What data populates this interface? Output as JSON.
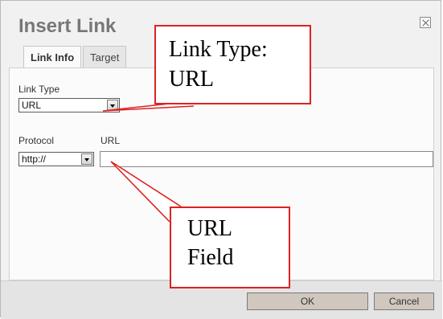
{
  "dialog": {
    "title": "Insert Link",
    "tabs": [
      {
        "label": "Link Info"
      },
      {
        "label": "Target"
      }
    ]
  },
  "form": {
    "link_type_label": "Link Type",
    "link_type_value": "URL",
    "protocol_label": "Protocol",
    "protocol_value": "http://",
    "url_label": "URL",
    "url_value": ""
  },
  "footer": {
    "ok_label": "OK",
    "cancel_label": "Cancel"
  },
  "annotations": {
    "link_type": "Link Type:\nURL",
    "url_field": "URL\nField"
  },
  "colors": {
    "callout_border": "#d22",
    "dialog_bg": "#f1f1f1"
  },
  "icons": {
    "close": "close-icon",
    "dropdown": "chevron-down-icon"
  }
}
